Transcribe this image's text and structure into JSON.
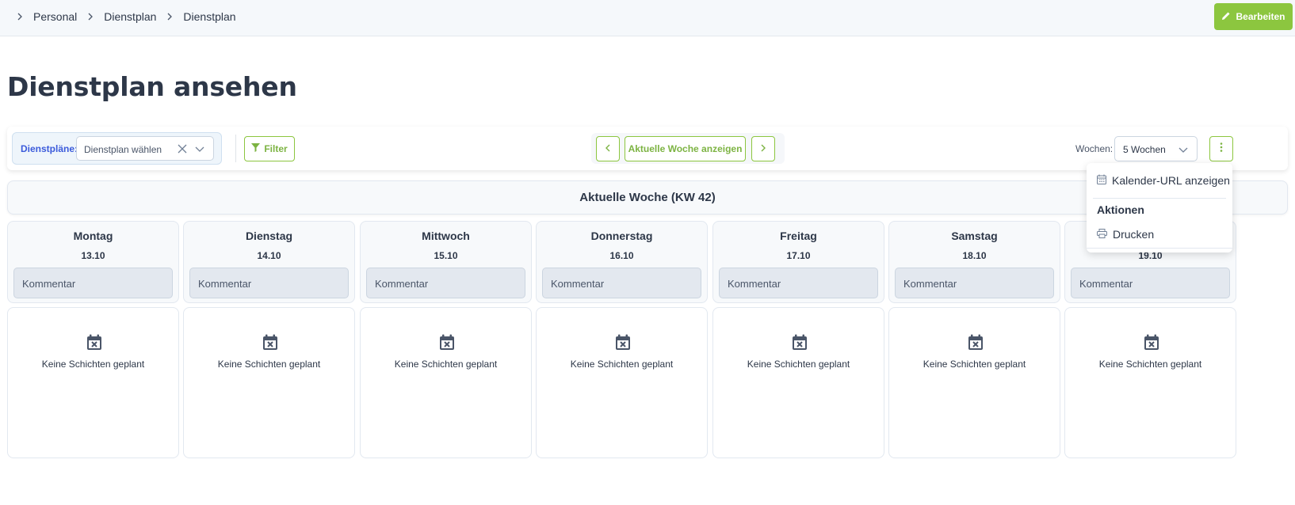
{
  "breadcrumb": [
    "Personal",
    "Dienstplan",
    "Dienstplan"
  ],
  "header": {
    "edit_label": "Bearbeiten"
  },
  "page": {
    "title": "Dienstplan ansehen"
  },
  "toolbar": {
    "plans_label": "Dienstpläne:",
    "plans_placeholder": "Dienstplan wählen",
    "filter_label": "Filter",
    "current_week_label": "Aktuelle Woche anzeigen",
    "weeks_label": "Wochen:",
    "weeks_value": "5 Wochen"
  },
  "week": {
    "title": "Aktuelle Woche (KW 42)",
    "days": [
      {
        "name": "Montag",
        "date": "13.10",
        "comment_placeholder": "Kommentar",
        "empty_text": "Keine Schichten geplant"
      },
      {
        "name": "Dienstag",
        "date": "14.10",
        "comment_placeholder": "Kommentar",
        "empty_text": "Keine Schichten geplant"
      },
      {
        "name": "Mittwoch",
        "date": "15.10",
        "comment_placeholder": "Kommentar",
        "empty_text": "Keine Schichten geplant"
      },
      {
        "name": "Donnerstag",
        "date": "16.10",
        "comment_placeholder": "Kommentar",
        "empty_text": "Keine Schichten geplant"
      },
      {
        "name": "Freitag",
        "date": "17.10",
        "comment_placeholder": "Kommentar",
        "empty_text": "Keine Schichten geplant"
      },
      {
        "name": "Samstag",
        "date": "18.10",
        "comment_placeholder": "Kommentar",
        "empty_text": "Keine Schichten geplant"
      },
      {
        "name": "",
        "date": "19.10",
        "comment_placeholder": "Kommentar",
        "empty_text": "Keine Schichten geplant"
      }
    ]
  },
  "menu": {
    "calendar_url_label": "Kalender-URL anzeigen",
    "actions_heading": "Aktionen",
    "print_label": "Drucken"
  },
  "colors": {
    "accent": "#8cc63f",
    "plan_label": "#3b5bdb"
  }
}
